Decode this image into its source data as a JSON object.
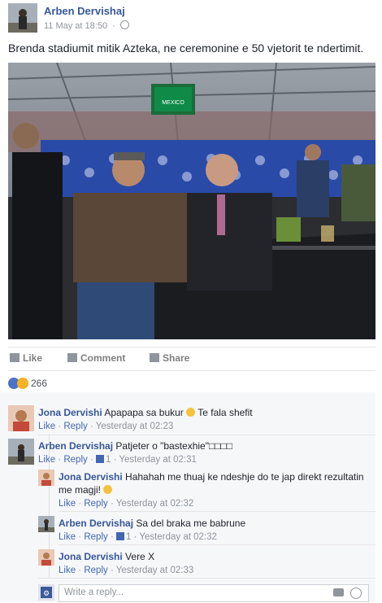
{
  "post": {
    "author": "Arben Dervishaj",
    "timestamp": "11 May at 18:50",
    "text": "Brenda stadiumit mitik Azteka, ne ceremonine e 50 vjetorit te ndertimit.",
    "photo_screen_text": "MEXICO"
  },
  "actions": {
    "like": "Like",
    "comment": "Comment",
    "share": "Share"
  },
  "reactions": {
    "count": "266",
    "types": [
      "like",
      "wow"
    ]
  },
  "comments": [
    {
      "name": "Jona Dervishi",
      "text": "Apapapa sa bukur",
      "text2": "Te fala shefit",
      "like": "Like",
      "reply": "Reply",
      "time": "Yesterday at 02:23"
    },
    {
      "name": "Arben Dervishaj",
      "text": "Patjeter o \"bastexhie\"□□□□",
      "like": "Like",
      "reply": "Reply",
      "likes": "1",
      "time": "Yesterday at 02:31"
    }
  ],
  "replies": [
    {
      "name": "Jona Dervishi",
      "text": "Hahahah me thuaj ke ndeshje do te jap direkt rezultatin",
      "text_line2": "me magji!",
      "like": "Like",
      "reply": "Reply",
      "time": "Yesterday at 02:32"
    },
    {
      "name": "Arben Dervishaj",
      "text": "Sa del braka me babrune",
      "like": "Like",
      "reply": "Reply",
      "likes": "1",
      "time": "Yesterday at 02:32"
    },
    {
      "name": "Jona Dervishi",
      "text": "Vere X",
      "like": "Like",
      "reply": "Reply",
      "time": "Yesterday at 02:33"
    }
  ],
  "reply_box": {
    "placeholder": "Write a reply..."
  },
  "colors": {
    "link": "#365899",
    "action": "#4267b2",
    "meta": "#90949c",
    "like_blue": "#4a74c9"
  }
}
